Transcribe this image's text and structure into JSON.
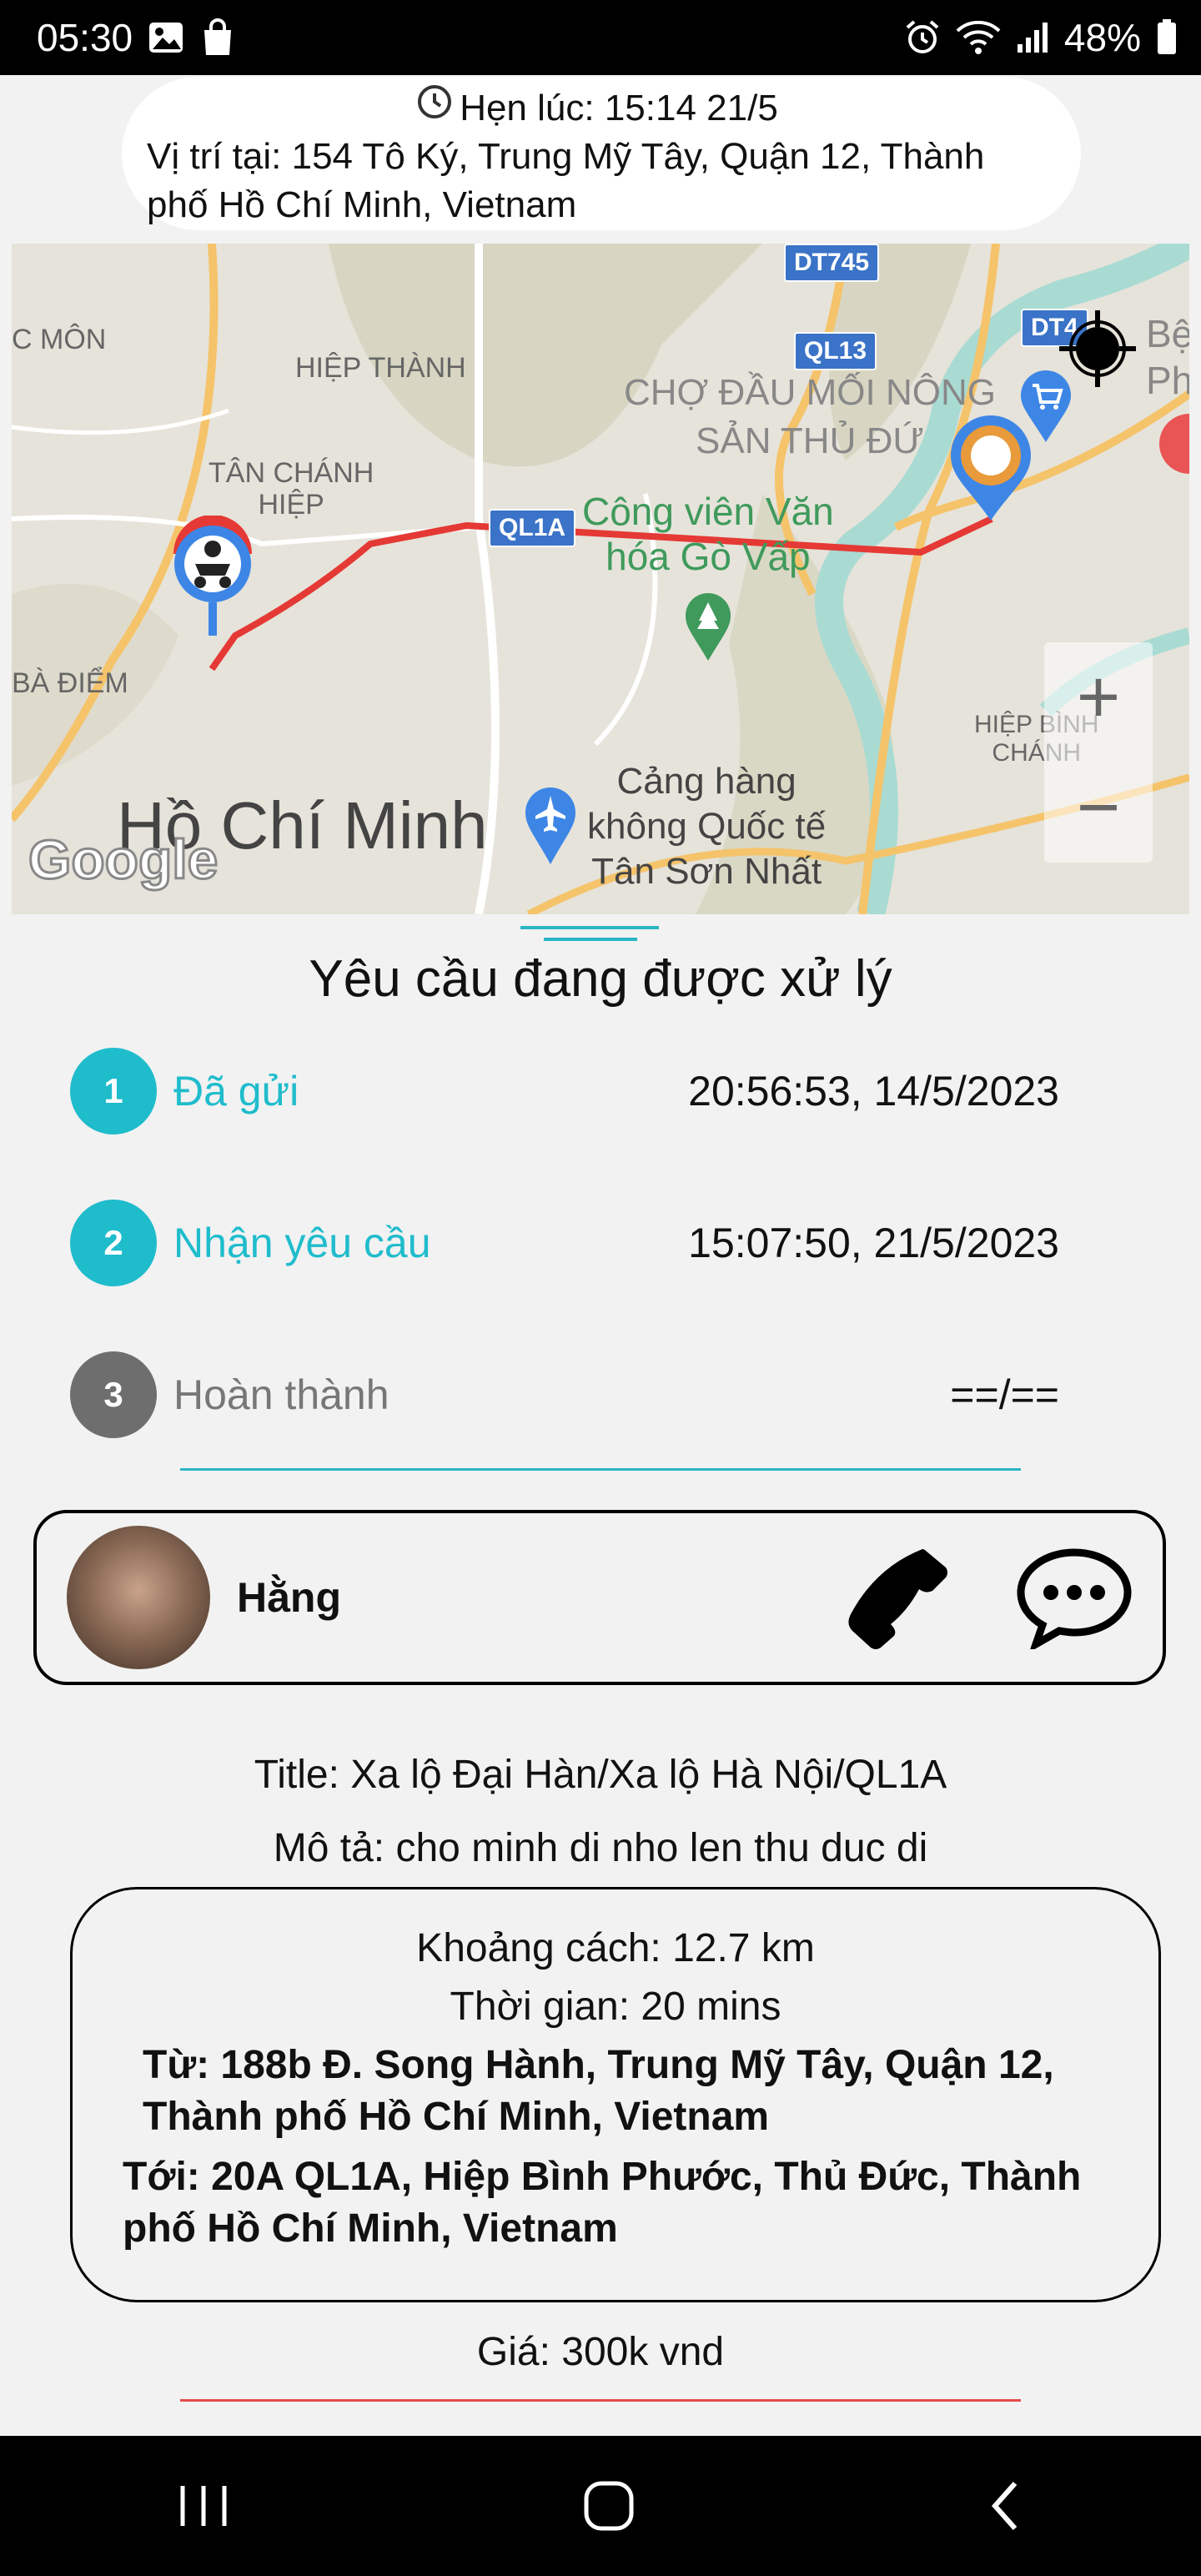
{
  "status_bar": {
    "time": "05:30",
    "battery": "48%"
  },
  "appointment": {
    "label": "Hẹn lúc: 15:14 21/5",
    "location": "Vị trí tại: 154 Tô Ký, Trung Mỹ Tây, Quận 12, Thành phố Hồ Chí Minh, Vietnam"
  },
  "map": {
    "labels": {
      "dt745": "DT745",
      "ql13": "QL13",
      "ql1a": "QL1A",
      "dt4": "DT4",
      "mon": "C MÔN",
      "hiep_thanh": "HIỆP THÀNH",
      "tan_chanh": "TÂN CHÁNH\nHIỆP",
      "cho_dau_moi": "CHỢ ĐẦU MỐI NÔNG\nSẢN THỦ ĐỨ",
      "cong_vien": "Công viên Văn\nhóa Gò Vấp",
      "ba_diem": "BÀ ĐIỂM",
      "hiep_binh": "HIỆP BÌNH\nCHÁNH",
      "city": "Hồ Chí Minh",
      "airport": "Cảng hàng\nkhông Quốc tế\nTân Sơn Nhất",
      "be": "Bệ\nPh",
      "google": "Google"
    },
    "zoom_in": "+",
    "zoom_out": "−"
  },
  "request": {
    "title": "Yêu cầu đang được xử lý",
    "steps": [
      {
        "num": "1",
        "label": "Đã gửi",
        "time": "20:56:53, 14/5/2023"
      },
      {
        "num": "2",
        "label": "Nhận yêu cầu",
        "time": "15:07:50, 21/5/2023"
      },
      {
        "num": "3",
        "label": "Hoàn thành",
        "time": "==/=="
      }
    ]
  },
  "driver": {
    "name": "Hằng"
  },
  "details": {
    "title": "Title: Xa lộ Đại Hàn/Xa lộ Hà Nội/QL1A",
    "description": "Mô tả: cho minh di nho len thu duc di"
  },
  "trip": {
    "distance": "Khoảng cách: 12.7 km",
    "duration": "Thời gian: 20 mins",
    "from": "Từ: 188b Đ. Song Hành, Trung Mỹ Tây, Quận 12, Thành phố Hồ Chí Minh, Vietnam",
    "to": "Tới: 20A QL1A, Hiệp Bình Phước, Thủ Đức, Thành phố Hồ Chí Minh, Vietnam"
  },
  "price": "Giá: 300k vnd",
  "colors": {
    "accent": "#1fbccc",
    "route": "#e53935",
    "inactive": "#6e6e6e",
    "divider_bottom": "#e84a4a"
  }
}
